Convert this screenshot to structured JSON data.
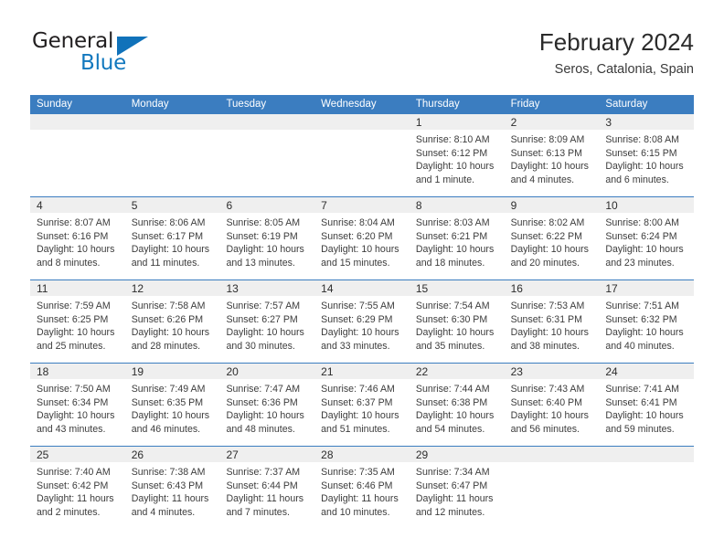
{
  "brand": {
    "name_part1": "General",
    "name_part2": "Blue",
    "colors": {
      "blue": "#1072ba",
      "dark": "#221f20"
    }
  },
  "header": {
    "title": "February 2024",
    "subtitle": "Seros, Catalonia, Spain"
  },
  "theme": {
    "header_bar": "#3b7dc0",
    "day_band": "#efefef",
    "text": "#3c3c3c"
  },
  "weekday_headers": [
    "Sunday",
    "Monday",
    "Tuesday",
    "Wednesday",
    "Thursday",
    "Friday",
    "Saturday"
  ],
  "weeks": [
    [
      {
        "day": "",
        "lines": []
      },
      {
        "day": "",
        "lines": []
      },
      {
        "day": "",
        "lines": []
      },
      {
        "day": "",
        "lines": []
      },
      {
        "day": "1",
        "lines": [
          "Sunrise: 8:10 AM",
          "Sunset: 6:12 PM",
          "Daylight: 10 hours",
          "and 1 minute."
        ]
      },
      {
        "day": "2",
        "lines": [
          "Sunrise: 8:09 AM",
          "Sunset: 6:13 PM",
          "Daylight: 10 hours",
          "and 4 minutes."
        ]
      },
      {
        "day": "3",
        "lines": [
          "Sunrise: 8:08 AM",
          "Sunset: 6:15 PM",
          "Daylight: 10 hours",
          "and 6 minutes."
        ]
      }
    ],
    [
      {
        "day": "4",
        "lines": [
          "Sunrise: 8:07 AM",
          "Sunset: 6:16 PM",
          "Daylight: 10 hours",
          "and 8 minutes."
        ]
      },
      {
        "day": "5",
        "lines": [
          "Sunrise: 8:06 AM",
          "Sunset: 6:17 PM",
          "Daylight: 10 hours",
          "and 11 minutes."
        ]
      },
      {
        "day": "6",
        "lines": [
          "Sunrise: 8:05 AM",
          "Sunset: 6:19 PM",
          "Daylight: 10 hours",
          "and 13 minutes."
        ]
      },
      {
        "day": "7",
        "lines": [
          "Sunrise: 8:04 AM",
          "Sunset: 6:20 PM",
          "Daylight: 10 hours",
          "and 15 minutes."
        ]
      },
      {
        "day": "8",
        "lines": [
          "Sunrise: 8:03 AM",
          "Sunset: 6:21 PM",
          "Daylight: 10 hours",
          "and 18 minutes."
        ]
      },
      {
        "day": "9",
        "lines": [
          "Sunrise: 8:02 AM",
          "Sunset: 6:22 PM",
          "Daylight: 10 hours",
          "and 20 minutes."
        ]
      },
      {
        "day": "10",
        "lines": [
          "Sunrise: 8:00 AM",
          "Sunset: 6:24 PM",
          "Daylight: 10 hours",
          "and 23 minutes."
        ]
      }
    ],
    [
      {
        "day": "11",
        "lines": [
          "Sunrise: 7:59 AM",
          "Sunset: 6:25 PM",
          "Daylight: 10 hours",
          "and 25 minutes."
        ]
      },
      {
        "day": "12",
        "lines": [
          "Sunrise: 7:58 AM",
          "Sunset: 6:26 PM",
          "Daylight: 10 hours",
          "and 28 minutes."
        ]
      },
      {
        "day": "13",
        "lines": [
          "Sunrise: 7:57 AM",
          "Sunset: 6:27 PM",
          "Daylight: 10 hours",
          "and 30 minutes."
        ]
      },
      {
        "day": "14",
        "lines": [
          "Sunrise: 7:55 AM",
          "Sunset: 6:29 PM",
          "Daylight: 10 hours",
          "and 33 minutes."
        ]
      },
      {
        "day": "15",
        "lines": [
          "Sunrise: 7:54 AM",
          "Sunset: 6:30 PM",
          "Daylight: 10 hours",
          "and 35 minutes."
        ]
      },
      {
        "day": "16",
        "lines": [
          "Sunrise: 7:53 AM",
          "Sunset: 6:31 PM",
          "Daylight: 10 hours",
          "and 38 minutes."
        ]
      },
      {
        "day": "17",
        "lines": [
          "Sunrise: 7:51 AM",
          "Sunset: 6:32 PM",
          "Daylight: 10 hours",
          "and 40 minutes."
        ]
      }
    ],
    [
      {
        "day": "18",
        "lines": [
          "Sunrise: 7:50 AM",
          "Sunset: 6:34 PM",
          "Daylight: 10 hours",
          "and 43 minutes."
        ]
      },
      {
        "day": "19",
        "lines": [
          "Sunrise: 7:49 AM",
          "Sunset: 6:35 PM",
          "Daylight: 10 hours",
          "and 46 minutes."
        ]
      },
      {
        "day": "20",
        "lines": [
          "Sunrise: 7:47 AM",
          "Sunset: 6:36 PM",
          "Daylight: 10 hours",
          "and 48 minutes."
        ]
      },
      {
        "day": "21",
        "lines": [
          "Sunrise: 7:46 AM",
          "Sunset: 6:37 PM",
          "Daylight: 10 hours",
          "and 51 minutes."
        ]
      },
      {
        "day": "22",
        "lines": [
          "Sunrise: 7:44 AM",
          "Sunset: 6:38 PM",
          "Daylight: 10 hours",
          "and 54 minutes."
        ]
      },
      {
        "day": "23",
        "lines": [
          "Sunrise: 7:43 AM",
          "Sunset: 6:40 PM",
          "Daylight: 10 hours",
          "and 56 minutes."
        ]
      },
      {
        "day": "24",
        "lines": [
          "Sunrise: 7:41 AM",
          "Sunset: 6:41 PM",
          "Daylight: 10 hours",
          "and 59 minutes."
        ]
      }
    ],
    [
      {
        "day": "25",
        "lines": [
          "Sunrise: 7:40 AM",
          "Sunset: 6:42 PM",
          "Daylight: 11 hours",
          "and 2 minutes."
        ]
      },
      {
        "day": "26",
        "lines": [
          "Sunrise: 7:38 AM",
          "Sunset: 6:43 PM",
          "Daylight: 11 hours",
          "and 4 minutes."
        ]
      },
      {
        "day": "27",
        "lines": [
          "Sunrise: 7:37 AM",
          "Sunset: 6:44 PM",
          "Daylight: 11 hours",
          "and 7 minutes."
        ]
      },
      {
        "day": "28",
        "lines": [
          "Sunrise: 7:35 AM",
          "Sunset: 6:46 PM",
          "Daylight: 11 hours",
          "and 10 minutes."
        ]
      },
      {
        "day": "29",
        "lines": [
          "Sunrise: 7:34 AM",
          "Sunset: 6:47 PM",
          "Daylight: 11 hours",
          "and 12 minutes."
        ]
      },
      {
        "day": "",
        "lines": []
      },
      {
        "day": "",
        "lines": []
      }
    ]
  ]
}
